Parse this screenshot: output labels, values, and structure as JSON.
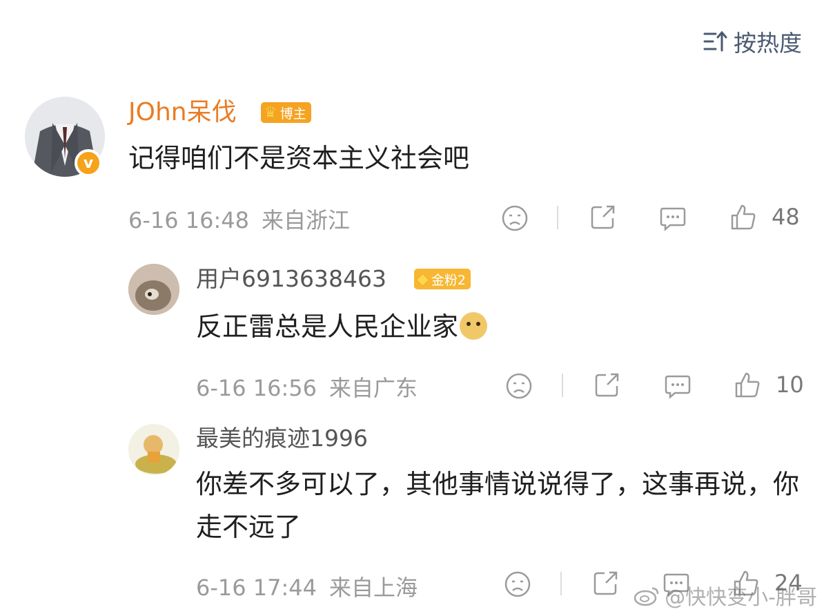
{
  "sort": {
    "label": "按热度",
    "icon": "sort-icon"
  },
  "comments": [
    {
      "username": "JOhn呆伐",
      "badge": "博主",
      "badge_level": "5",
      "verified_icon": "v",
      "text": "记得咱们不是资本主义社会吧",
      "date": "6-16 16:48",
      "location": "来自浙江",
      "likes": "48"
    },
    {
      "username": "用户6913638463",
      "badge": "金粉2",
      "text": "反正雷总是人民企业家",
      "date": "6-16 16:56",
      "location": "来自广东",
      "likes": "10"
    },
    {
      "username": "最美的痕迹1996",
      "text": "你差不多可以了，其他事情说说得了，这事再说，你走不远了",
      "date": "6-16 17:44",
      "location": "来自上海",
      "likes": "24"
    }
  ],
  "watermark": "@快快变小-胖哥",
  "colors": {
    "username_main": "#eb7b22",
    "badge": "#f5a322",
    "sort_text": "#4a5a70",
    "meta": "#9a9a9a"
  }
}
